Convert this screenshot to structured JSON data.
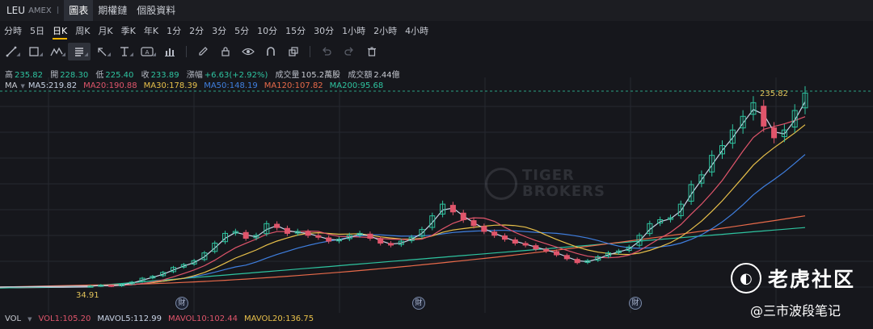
{
  "header": {
    "ticker": "LEU",
    "exchange": "AMEX",
    "separator": "I",
    "tabs": [
      {
        "label": "圖表",
        "active": true
      },
      {
        "label": "期權鏈",
        "active": false
      },
      {
        "label": "個股資料",
        "active": false
      }
    ]
  },
  "periods": [
    "分時",
    "5日",
    "日K",
    "周K",
    "月K",
    "季K",
    "年K",
    "1分",
    "2分",
    "3分",
    "5分",
    "10分",
    "15分",
    "30分",
    "1小時",
    "2小時",
    "4小時"
  ],
  "active_period": "日K",
  "toolbar": {
    "icons": [
      "line-tool-icon",
      "rect-tool-icon",
      "pattern-tool-icon",
      "text-list-icon",
      "arrow-tool-icon",
      "text-tool-icon",
      "label-tool-icon",
      "measure-tool-icon",
      "pencil-icon",
      "lock-icon",
      "eye-icon",
      "magnet-icon",
      "copy-icon",
      "undo-icon",
      "redo-icon",
      "trash-icon"
    ]
  },
  "quote": {
    "high_label": "高",
    "high": "235.82",
    "open_label": "開",
    "open": "228.30",
    "low_label": "低",
    "low": "225.40",
    "close_label": "收",
    "close": "233.89",
    "change_label": "漲幅",
    "change": "+6.63(+2.92%)",
    "volume_label": "成交量",
    "volume": "105.2萬股",
    "turnover_label": "成交額",
    "turnover": "2.44億"
  },
  "ma": {
    "title": "MA",
    "items": [
      {
        "label": "MA5:219.82",
        "color": "#c9d4e6"
      },
      {
        "label": "MA20:190.88",
        "color": "#e0556b"
      },
      {
        "label": "MA30:178.39",
        "color": "#e8c04a"
      },
      {
        "label": "MA50:148.19",
        "color": "#3f7fe0"
      },
      {
        "label": "MA120:107.82",
        "color": "#e86a4a"
      },
      {
        "label": "MA200:95.68",
        "color": "#2ec4a0"
      }
    ]
  },
  "volume_indicator": {
    "title": "VOL",
    "items": [
      {
        "label": "VOL1:105.20",
        "color": "#e0556b"
      },
      {
        "label": "MAVOL5:112.99",
        "color": "#c9d4e6"
      },
      {
        "label": "MAVOL10:102.44",
        "color": "#e0556b"
      },
      {
        "label": "MAVOL20:136.75",
        "color": "#e8c04a"
      }
    ]
  },
  "chart_data": {
    "type": "candlestick",
    "last_price_label": "235.82",
    "low_marker_label": "34.91",
    "earnings_marker": "財",
    "close_approx": [
      36,
      37,
      36,
      38,
      40,
      44,
      46,
      50,
      55,
      58,
      62,
      70,
      80,
      90,
      92,
      85,
      88,
      100,
      96,
      90,
      92,
      88,
      86,
      82,
      84,
      88,
      90,
      85,
      80,
      78,
      82,
      86,
      94,
      108,
      120,
      112,
      104,
      98,
      92,
      88,
      84,
      80,
      78,
      74,
      72,
      68,
      64,
      60,
      62,
      66,
      70,
      72,
      76,
      88,
      100,
      104,
      106,
      120,
      140,
      150,
      170,
      180,
      196,
      210,
      224,
      200,
      188,
      196,
      216,
      233.89
    ]
  },
  "watermark": {
    "line1": "TIGER",
    "line2": "BROKERS"
  },
  "branding": {
    "name": "老虎社区",
    "author": "@三市波段笔记"
  },
  "colors": {
    "up": "#2ec4a0",
    "down": "#e0556b",
    "accent": "#f0b400",
    "background": "#16171c"
  }
}
